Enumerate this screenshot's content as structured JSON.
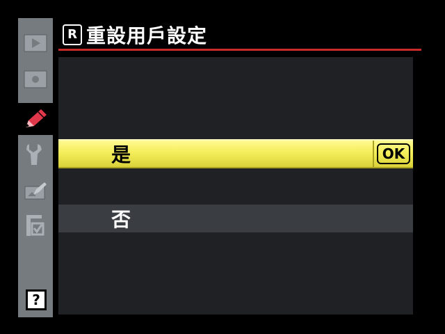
{
  "header": {
    "mode_badge": "R",
    "title": "重設用戶設定"
  },
  "sidebar": {
    "items": [
      {
        "icon": "playback-icon"
      },
      {
        "icon": "shooting-icon"
      },
      {
        "icon": "custom-settings-pencil-icon",
        "active": true
      },
      {
        "icon": "setup-wrench-icon"
      },
      {
        "icon": "retouch-icon"
      },
      {
        "icon": "my-menu-icon"
      }
    ],
    "help_label": "?"
  },
  "options": [
    {
      "label": "是",
      "selected": true,
      "confirm_badge": "OK"
    },
    {
      "label": "否",
      "selected": false
    }
  ],
  "colors": {
    "accent_rule": "#c82a2a",
    "selection": "#f4ee5a",
    "active_icon": "#e0384a"
  }
}
